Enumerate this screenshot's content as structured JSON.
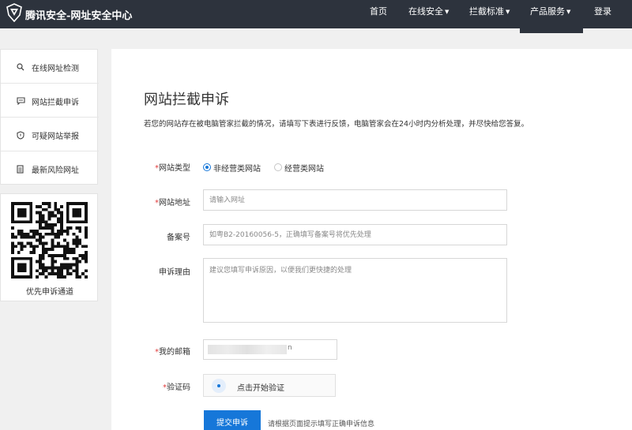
{
  "header": {
    "brand": "腾讯安全-网址安全中心",
    "nav": [
      {
        "label": "首页",
        "caret": ""
      },
      {
        "label": "在线安全",
        "caret": "▼"
      },
      {
        "label": "拦截标准",
        "caret": "▼"
      },
      {
        "label": "产品服务",
        "caret": "▼"
      },
      {
        "label": "登录",
        "caret": ""
      }
    ]
  },
  "sidebar": {
    "items": [
      {
        "label": "在线网址检测",
        "icon": "search-icon"
      },
      {
        "label": "网站拦截申诉",
        "icon": "chat-icon"
      },
      {
        "label": "可疑网站举报",
        "icon": "shield-icon"
      },
      {
        "label": "最新风险网址",
        "icon": "document-icon"
      }
    ],
    "qr_caption": "优先申诉通道"
  },
  "main": {
    "title": "网站拦截申诉",
    "description": "若您的网站存在被电脑管家拦截的情况，请填写下表进行反馈，电脑管家会在24小时内分析处理，并尽快给您答复。",
    "form": {
      "site_type": {
        "required_mark": "*",
        "label": "网站类型",
        "options": [
          "非经营类网站",
          "经营类网站"
        ],
        "selected": "非经营类网站"
      },
      "site_url": {
        "required_mark": "*",
        "label": "网站地址",
        "placeholder": "请输入网址",
        "value": ""
      },
      "icp": {
        "label": "备案号",
        "placeholder": "如粤B2-20160056-5，正确填写备案号将优先处理",
        "value": ""
      },
      "reason": {
        "label": "申诉理由",
        "placeholder": "建议您填写申诉原因，以便我们更快捷的处理",
        "value": ""
      },
      "email": {
        "required_mark": "*",
        "label": "我的邮箱",
        "visible_tail": "n"
      },
      "captcha": {
        "required_mark": "*",
        "label": "验证码",
        "button": "点击开始验证"
      },
      "submit": "提交申诉",
      "hint": "请根据页面提示填写正确申诉信息"
    }
  },
  "colors": {
    "header_bg": "#2d333d",
    "accent": "#1677d9",
    "required": "#e23b3b",
    "page_bg": "#f0f0f0"
  }
}
